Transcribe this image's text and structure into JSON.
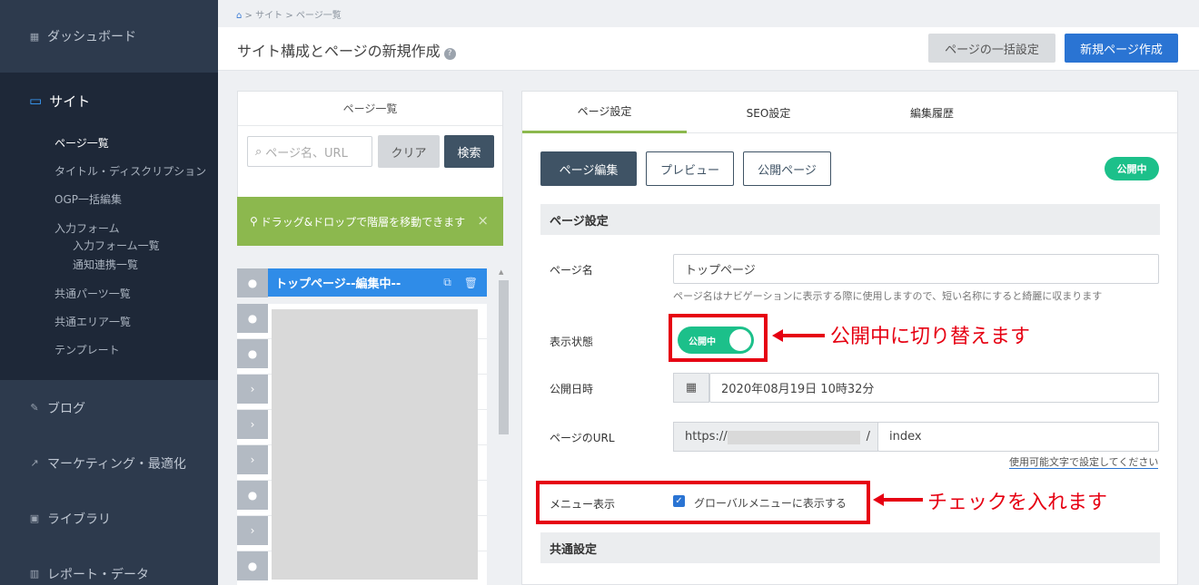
{
  "sidebar": {
    "dashboard": "ダッシュボード",
    "site": "サイト",
    "site_items": [
      "ページ一覧",
      "タイトル・ディスクリプション",
      "OGP一括編集",
      "入力フォーム"
    ],
    "form_sub_items": [
      "入力フォーム一覧",
      "通知連携一覧"
    ],
    "site_items2": [
      "共通パーツ一覧",
      "共通エリア一覧",
      "テンプレート"
    ],
    "blog": "ブログ",
    "marketing": "マーケティング・最適化",
    "library": "ライブラリ",
    "report": "レポート・データ"
  },
  "breadcrumb": {
    "site": "サイト",
    "page_list": "ページ一覧",
    "sep": ">"
  },
  "header": {
    "title": "サイト構成とページの新規作成",
    "help": "?",
    "bulk_button": "ページの一括設定",
    "new_button": "新規ページ作成"
  },
  "left_panel": {
    "title": "ページ一覧",
    "search_placeholder": "ページ名、URL",
    "clear_button": "クリア",
    "search_button": "検索",
    "hint": "ドラッグ&ドロップで階層を移動できます",
    "hint_close": "×",
    "tree_first_label": "トップページ--編集中--"
  },
  "right_panel": {
    "tabs": [
      "ページ設定",
      "SEO設定",
      "編集履歴"
    ],
    "edit_button": "ページ編集",
    "preview_button": "プレビュー",
    "public_page_button": "公開ページ",
    "status_badge": "公開中",
    "section_page_settings": "ページ設定",
    "page_name_label": "ページ名",
    "page_name_value": "トップページ",
    "page_name_help": "ページ名はナビゲーションに表示する際に使用しますので、短い名称にすると綺麗に収まります",
    "display_state_label": "表示状態",
    "toggle_text": "公開中",
    "publish_date_label": "公開日時",
    "publish_date_value": "2020年08月19日 10時32分",
    "url_label": "ページのURL",
    "url_prefix": "https://",
    "url_slash": "/",
    "url_value": "index",
    "url_help": "使用可能文字で設定してください",
    "menu_label": "メニュー表示",
    "menu_checkbox_label": "グローバルメニューに表示する",
    "section_common": "共通設定"
  },
  "annotations": {
    "toggle_note": "公開中に切り替えます",
    "checkbox_note": "チェックを入れます"
  },
  "colors": {
    "accent": "#2a74d3",
    "success": "#1cc08a",
    "annotation": "#e60012",
    "hint": "#8cb84e",
    "sidebar": "#2d3a4d"
  }
}
